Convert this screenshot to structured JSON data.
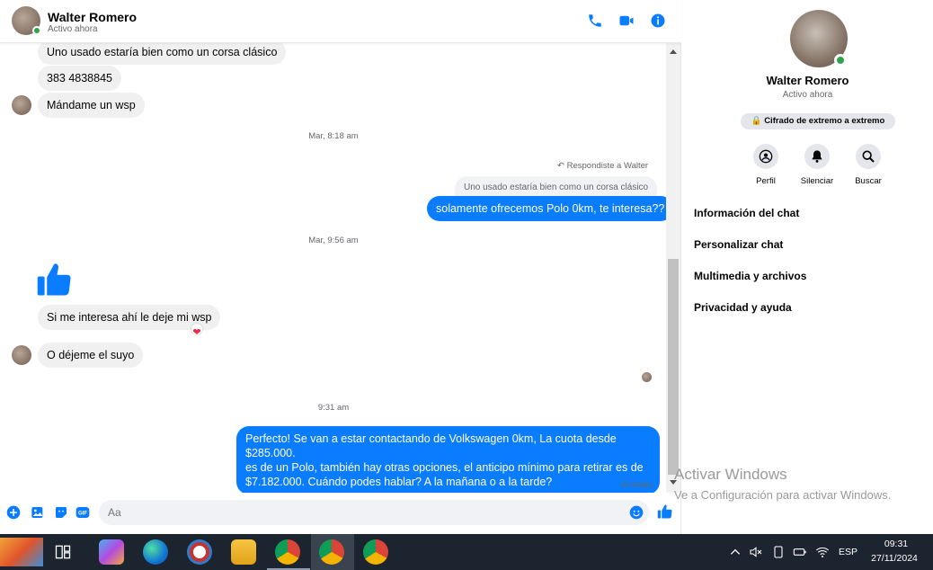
{
  "header": {
    "name": "Walter Romero",
    "status": "Activo ahora"
  },
  "messages": {
    "m1": "Uno usado estaría bien como un corsa clásico",
    "m2": "383 4838845",
    "m3": "Mándame un wsp",
    "ts1": "Mar, 8:18 am",
    "reply_label": "Respondiste a Walter",
    "reply_quote": "Uno usado estaría bien como un corsa clásico",
    "m4": "solamente ofrecemos Polo 0km, te interesa??",
    "ts2": "Mar, 9:56 am",
    "m5": "Si me interesa ahí le deje mi wsp",
    "m6": "O déjeme el suyo",
    "ts3": "9:31 am",
    "m7_line1": "Perfecto!  Se van a estar contactando de Volkswagen 0km, La cuota desde $285.000.",
    "m7_line2": "es de un Polo, también hay otras opciones, el anticipo mínimo para retirar es de",
    "m7_line3": "$7.182.000. Cuándo podes hablar? A la mañana o a la tarde?",
    "sent_status": "Enviado"
  },
  "composer": {
    "placeholder": "Aa"
  },
  "panel": {
    "name": "Walter Romero",
    "status": "Activo ahora",
    "encryption": "Cifrado de extremo a extremo",
    "actions": [
      "Perfil",
      "Silenciar",
      "Buscar"
    ],
    "menu": [
      "Información del chat",
      "Personalizar chat",
      "Multimedia y archivos",
      "Privacidad y ayuda"
    ]
  },
  "watermark": {
    "line1": "Activar Windows",
    "line2": "Ve a Configuración para activar Windows."
  },
  "taskbar": {
    "lang": "ESP",
    "time": "09:31",
    "date": "27/11/2024"
  },
  "colors": {
    "accent": "#0a7cff",
    "online": "#31a24c"
  }
}
